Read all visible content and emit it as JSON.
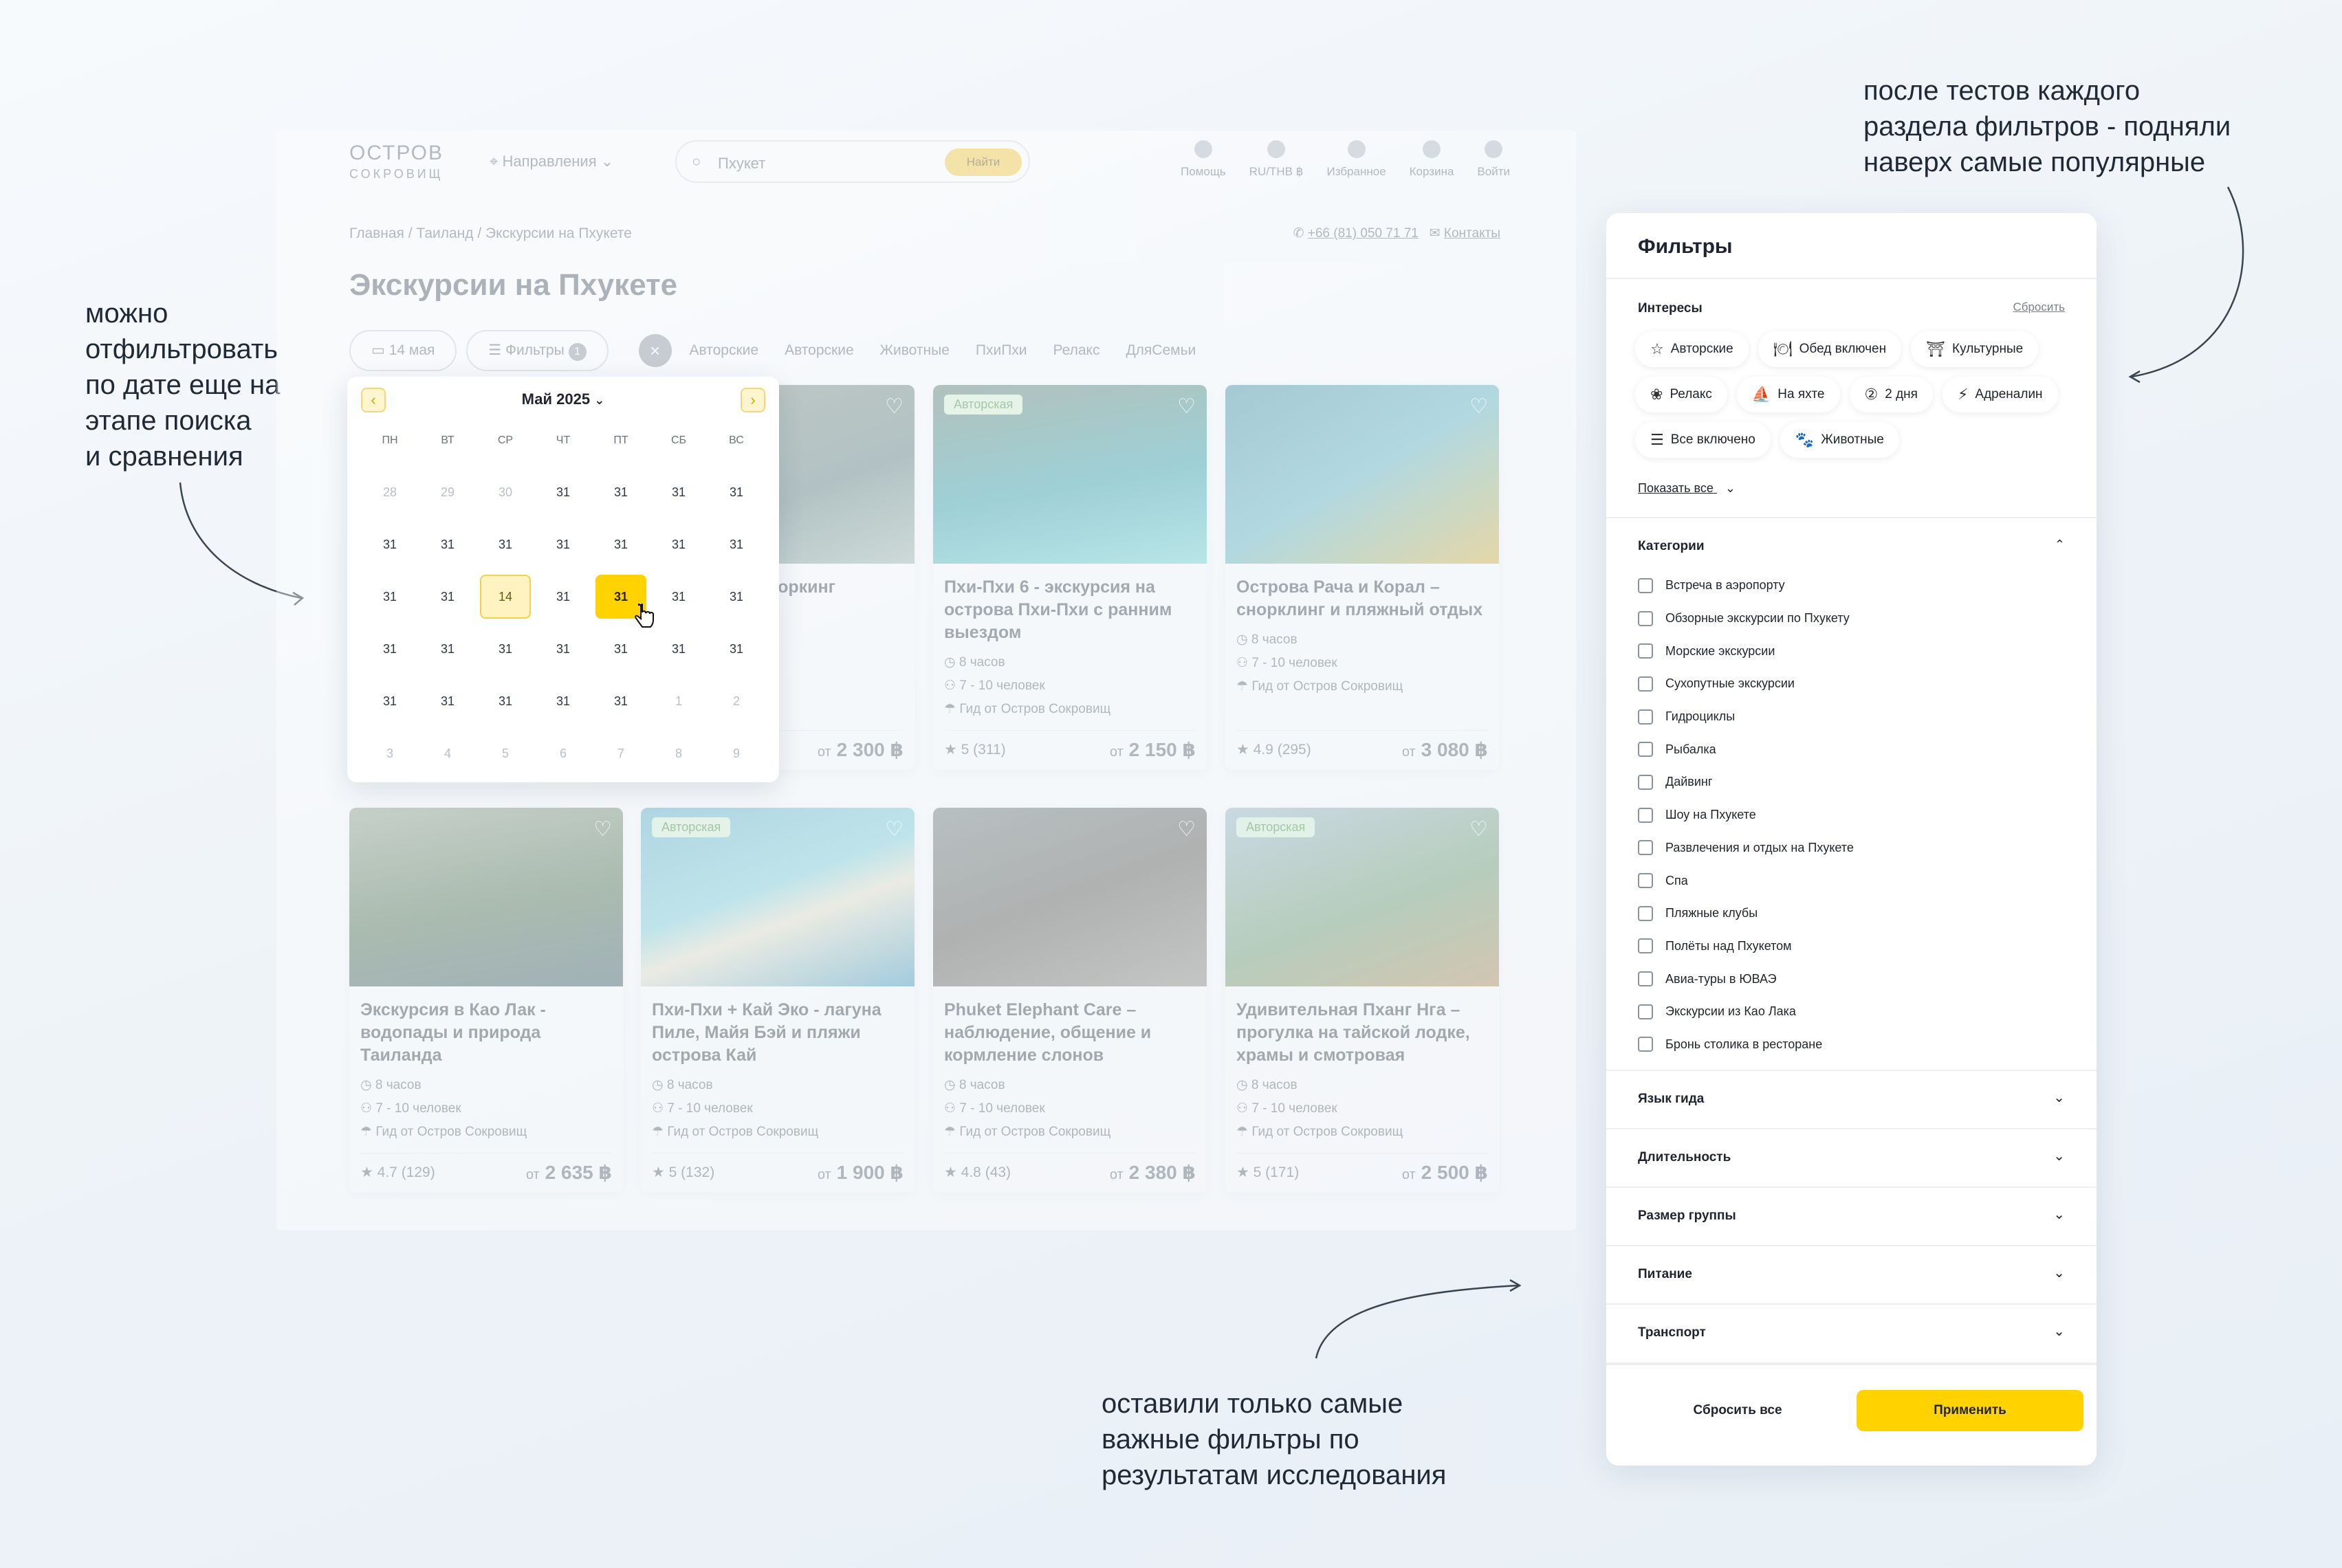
{
  "annotations": {
    "left": [
      "можно",
      "отфильтровать",
      "по дате еще на",
      "этапе поиска",
      "и сравнения"
    ],
    "top_right": [
      "после тестов каждого",
      "раздела фильтров - подняли",
      "наверх самые популярные"
    ],
    "bottom": [
      "оставили только самые",
      "важные фильтры по",
      "результатам исследования"
    ]
  },
  "site": {
    "logo_top": "ОСТРОВ",
    "logo_bottom": "СОКРОВИЩ",
    "directions": "Направления",
    "search_placeholder": "Пхукет",
    "search_button": "Найти",
    "header_icons": [
      {
        "label": "Помощь",
        "icon": "pin-icon"
      },
      {
        "label": "RU/THB ฿",
        "icon": "globe-icon"
      },
      {
        "label": "Избранное",
        "icon": "heart-icon"
      },
      {
        "label": "Корзина",
        "icon": "bag-icon"
      },
      {
        "label": "Войти",
        "icon": "user-icon"
      }
    ],
    "breadcrumbs": "Главная / Таиланд / Экскурсии на Пхукете",
    "phone": "+66 (81) 050 71 71",
    "contacts": "Контакты",
    "title": "Экскурсии на Пхукете",
    "date_chip": "14 мая",
    "filters_chip": "Фильтры",
    "filters_count": "1",
    "category_chips": [
      "Авторские",
      "Авторские",
      "Животные",
      "ПхиПхи",
      "Релакс",
      "ДляСемьи"
    ],
    "cards": [
      {
        "title": "…бу – бухта …оркинг",
        "tag": "",
        "duration": "",
        "people": "",
        "guide": "…а",
        "rating": "",
        "price_prefix": "от",
        "price": "2 300 ฿"
      },
      {
        "title": "Пхи-Пхи 6 - экскурсия на острова Пхи-Пхи с ранним выездом",
        "tag": "Авторская",
        "duration": "8 часов",
        "people": "7 - 10 человек",
        "guide": "Гид от Остров Сокровищ",
        "rating": "5 (311)",
        "price_prefix": "от",
        "price": "2 150 ฿"
      },
      {
        "title": "Острова Рача и Корал – снорклинг и пляжный отдых",
        "tag": "",
        "duration": "8 часов",
        "people": "7 - 10 человек",
        "guide": "Гид от Остров Сокровищ",
        "rating": "4.9 (295)",
        "price_prefix": "от",
        "price": "3 080 ฿"
      },
      {
        "title": "Экскурсия в Као Лак - водопады и природа Таиланда",
        "tag": "",
        "duration": "8 часов",
        "people": "7 - 10 человек",
        "guide": "Гид от Остров Сокровищ",
        "rating": "4.7 (129)",
        "price_prefix": "от",
        "price": "2 635 ฿"
      },
      {
        "title": "Пхи-Пхи + Кай Эко - лагуна Пиле, Майя Бэй и пляжи острова Кай",
        "tag": "Авторская",
        "duration": "8 часов",
        "people": "7 - 10 человек",
        "guide": "Гид от Остров Сокровищ",
        "rating": "5 (132)",
        "price_prefix": "от",
        "price": "1 900 ฿"
      },
      {
        "title": "Phuket Elephant Care – наблюдение, общение и кормление слонов",
        "tag": "",
        "duration": "8 часов",
        "people": "7 - 10 человек",
        "guide": "Гид от Остров Сокровищ",
        "rating": "4.8 (43)",
        "price_prefix": "от",
        "price": "2 380 ฿"
      },
      {
        "title": "Удивительная Пханг Нга – прогулка на тайской лодке, храмы и смотровая",
        "tag": "Авторская",
        "duration": "8 часов",
        "people": "7 - 10 человек",
        "guide": "Гид от Остров Сокровищ",
        "rating": "5 (171)",
        "price_prefix": "от",
        "price": "2 500 ฿"
      }
    ]
  },
  "calendar": {
    "month": "Май 2025",
    "prev": "‹",
    "next": "›",
    "dows": [
      "ПН",
      "ВТ",
      "СР",
      "ЧТ",
      "ПТ",
      "СБ",
      "ВС"
    ],
    "days": [
      {
        "t": "28",
        "s": "dim"
      },
      {
        "t": "29",
        "s": "dim"
      },
      {
        "t": "30",
        "s": "dim"
      },
      {
        "t": "31"
      },
      {
        "t": "31"
      },
      {
        "t": "31"
      },
      {
        "t": "31"
      },
      {
        "t": "31"
      },
      {
        "t": "31"
      },
      {
        "t": "31"
      },
      {
        "t": "31"
      },
      {
        "t": "31"
      },
      {
        "t": "31"
      },
      {
        "t": "31"
      },
      {
        "t": "31"
      },
      {
        "t": "31"
      },
      {
        "t": "14",
        "s": "today"
      },
      {
        "t": "31"
      },
      {
        "t": "31",
        "s": "sel"
      },
      {
        "t": "31"
      },
      {
        "t": "31"
      },
      {
        "t": "31"
      },
      {
        "t": "31"
      },
      {
        "t": "31"
      },
      {
        "t": "31"
      },
      {
        "t": "31"
      },
      {
        "t": "31"
      },
      {
        "t": "31"
      },
      {
        "t": "31"
      },
      {
        "t": "31"
      },
      {
        "t": "31"
      },
      {
        "t": "31"
      },
      {
        "t": "31"
      },
      {
        "t": "1",
        "s": "dim"
      },
      {
        "t": "2",
        "s": "dim"
      },
      {
        "t": "3",
        "s": "dim"
      },
      {
        "t": "4",
        "s": "dim"
      },
      {
        "t": "5",
        "s": "dim"
      },
      {
        "t": "6",
        "s": "dim"
      },
      {
        "t": "7",
        "s": "dim"
      },
      {
        "t": "8",
        "s": "dim"
      },
      {
        "t": "9",
        "s": "dim"
      }
    ]
  },
  "filters": {
    "title": "Фильтры",
    "interests": {
      "label": "Интересы",
      "reset": "Сбросить",
      "tags": [
        {
          "label": "Авторские",
          "icon": "star-icon",
          "glyph": "☆"
        },
        {
          "label": "Обед включен",
          "icon": "plate-icon",
          "glyph": "🍽"
        },
        {
          "label": "Культурные",
          "icon": "temple-icon",
          "glyph": "⛩"
        },
        {
          "label": "Релакс",
          "icon": "lotus-icon",
          "glyph": "❀"
        },
        {
          "label": "На яхте",
          "icon": "yacht-icon",
          "glyph": "⛵"
        },
        {
          "label": "2 дня",
          "icon": "two-days-icon",
          "glyph": "②"
        },
        {
          "label": "Адреналин",
          "icon": "lightning-icon",
          "glyph": "⚡"
        },
        {
          "label": "Все включено",
          "icon": "checklist-icon",
          "glyph": "☰"
        },
        {
          "label": "Животные",
          "icon": "paw-icon",
          "glyph": "🐾"
        }
      ],
      "show_all": "Показать все"
    },
    "categories": {
      "label": "Категории",
      "items": [
        "Встреча в аэропорту",
        "Обзорные экскурсии по Пхукету",
        "Морские экскурсии",
        "Сухопутные экскурсии",
        "Гидроциклы",
        "Рыбалка",
        "Дайвинг",
        "Шоу на Пхукете",
        "Развлечения и отдых на Пхукете",
        "Спа",
        "Пляжные клубы",
        "Полёты над Пхукетом",
        "Авиа-туры в ЮВАЭ",
        "Экскурсии из Као Лака",
        "Бронь столика в ресторане"
      ]
    },
    "accordions": [
      "Язык гида",
      "Длительность",
      "Размер группы",
      "Питание",
      "Транспорт"
    ],
    "reset_all": "Сбросить все",
    "apply": "Применить"
  },
  "colors": {
    "accent": "#ffd200",
    "today_bg": "#fff3c2",
    "tag_green": "#d7f2d3"
  }
}
